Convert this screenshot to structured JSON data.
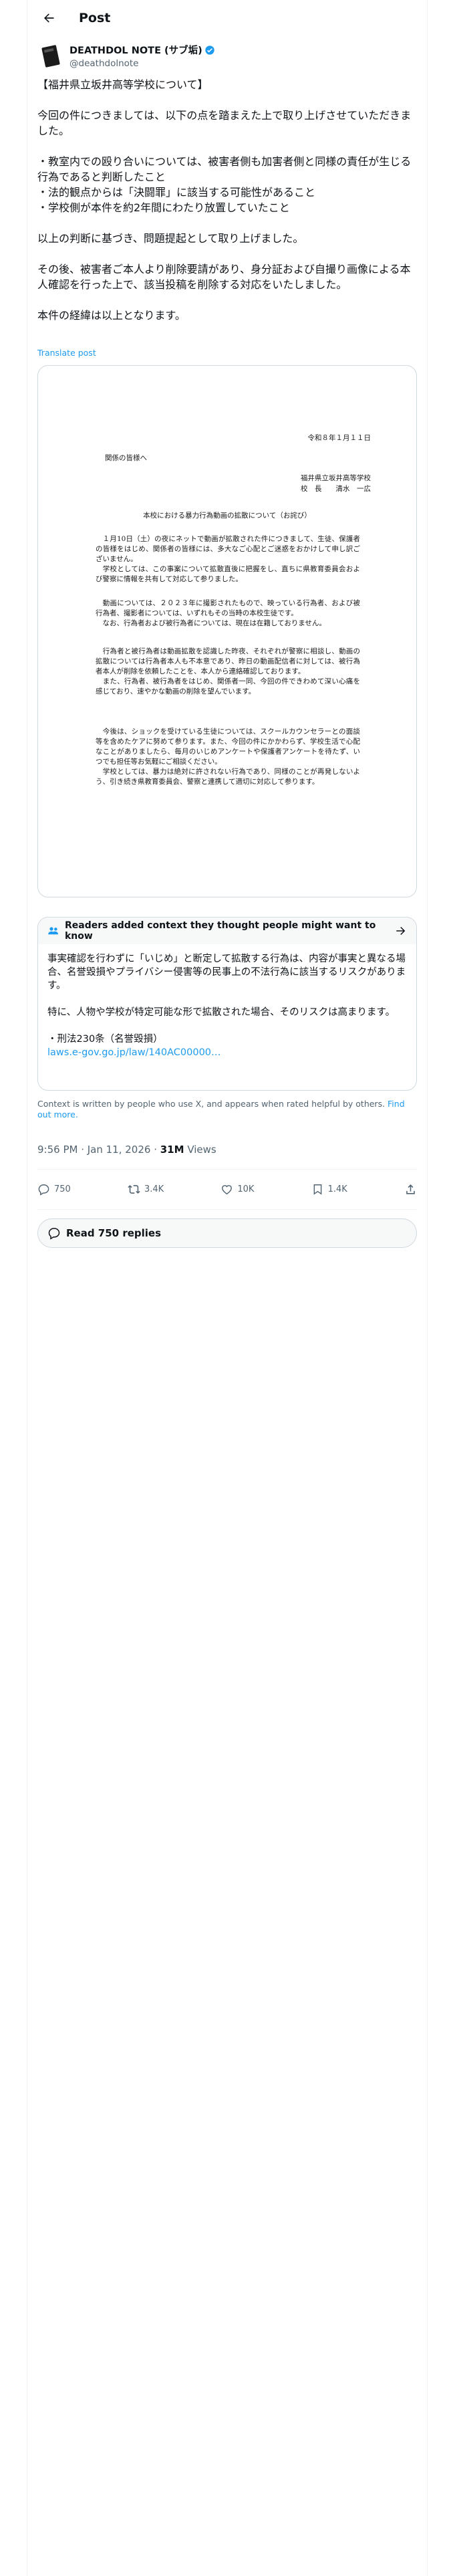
{
  "header": {
    "title": "Post"
  },
  "author": {
    "display_name": "DEATHDOL NOTE (サブ垢)",
    "handle": "@deathdolnote"
  },
  "post": {
    "text": "【福井県立坂井高等学校について】\n\n今回の件につきましては、以下の点を踏まえた上で取り上げさせていただきました。\n\n・教室内での殴り合いについては、被害者側も加害者側と同様の責任が生じる行為であると判断したこと\n・法的観点からは「決闘罪」に該当する可能性があること\n・学校側が本件を約2年間にわたり放置していたこと\n\n以上の判断に基づき、問題提起として取り上げました。\n\nその後、被害者ご本人より削除要請があり、身分証および自撮り画像による本人確認を行った上で、該当投稿を削除する対応をいたしました。\n\n本件の経緯は以上となります。",
    "translate": "Translate post"
  },
  "document": {
    "date": "令和８年１月１１日",
    "to": "関係の皆様へ",
    "org": "福井県立坂井高等学校",
    "principal": "校　長　　清水　一広",
    "title": "本校における暴力行為動画の拡散について（お詫び）",
    "p1": "　１月10日（土）の夜にネットで動画が拡散された件につきまして、生徒、保護者の皆様をはじめ、関係者の皆様には、多大なご心配とご迷惑をおかけして申し訳ございません。\n　学校としては、この事案について拡散直後に把握をし、直ちに県教育委員会および警察に情報を共有して対応して参りました。",
    "p2": "　動画については、２０２３年に撮影されたもので、映っている行為者、および被行為者、撮影者については、いずれもその当時の本校生徒です。\n　なお、行為者および被行為者については、現在は在籍しておりません。",
    "p3": "　行為者と被行為者は動画拡散を認識した昨夜、それぞれが警察に相談し、動画の拡散については行為者本人も不本意であり、昨日の動画配信者に対しては、被行為者本人が削除を依頼したことを、本人から連絡確認しております。\n　また、行為者、被行為者をはじめ、関係者一同、今回の件できわめて深い心痛を感じており、速やかな動画の削除を望んでいます。",
    "p4": "　今後は、ショックを受けている生徒については、スクールカウンセラーとの面談等を含めたケアに努めて参ります。また、今回の件にかかわらず、学校生活で心配なことがありましたら、毎月のいじめアンケートや保護者アンケートを待たず、いつでも担任等お気軽にご相談ください。\n　学校としては、暴力は絶対に許されない行為であり、同様のことが再発しないよう、引き続き県教育委員会、警察と連携して適切に対応して参ります。"
  },
  "community_note": {
    "heading": "Readers added context they thought people might want to know",
    "text": "事実確認を行わずに「いじめ」と断定して拡散する行為は、内容が事実と異なる場合、名誉毀損やプライバシー侵害等の民事上の不法行為に該当するリスクがあります。\n\n特に、人物や学校が特定可能な形で拡散された場合、そのリスクは高まります。\n\n・刑法230条（名誉毀損）\n",
    "link": "laws.e-gov.go.jp/law/140AC00000…"
  },
  "context_footer": {
    "text": "Context is written by people who use X, and appears when rated helpful by others. ",
    "link": "Find out more."
  },
  "meta": {
    "time": "9:56 PM · Jan 11, 2026 · ",
    "views": "31M",
    "views_label": " Views"
  },
  "actions": {
    "replies": "750",
    "reposts": "3.4K",
    "likes": "10K",
    "bookmarks": "1.4K"
  },
  "read_replies": "Read 750 replies",
  "colors": {
    "accent": "#1d9bf0",
    "muted": "#536471",
    "border": "#cfd9de"
  }
}
